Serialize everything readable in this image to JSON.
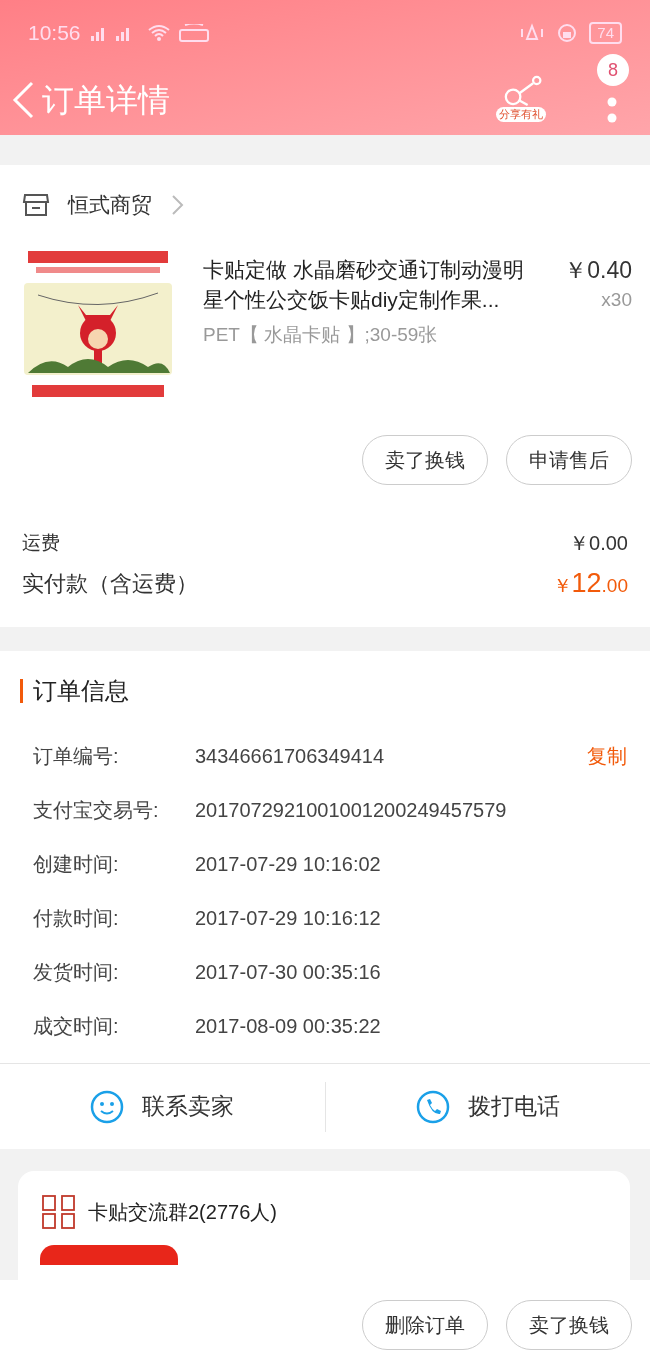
{
  "status_bar": {
    "time": "10:56",
    "battery": "74"
  },
  "header": {
    "title": "订单详情",
    "share_label": "分享有礼",
    "badge": "8"
  },
  "shop": {
    "name": "恒式商贸"
  },
  "product": {
    "kind": "picture",
    "title": "卡贴定做 水晶磨砂交通订制动漫明星个性公交饭卡贴diy定制作果...",
    "sku": "PET【 水晶卡贴 】;30-59张",
    "price": "￥0.40",
    "quantity": "x30"
  },
  "product_actions": [
    "卖了换钱",
    "申请售后"
  ],
  "summary": {
    "shipping_label": "运费",
    "shipping_value": "￥0.00",
    "paid_label": "实付款（含运费）",
    "paid_currency": "￥",
    "paid_integer": "12",
    "paid_decimal": ".00"
  },
  "order_info": {
    "title": "订单信息",
    "copy_label": "复制",
    "rows": [
      {
        "label": "订单编号:",
        "value": "34346661706349414"
      },
      {
        "label": "支付宝交易号:",
        "value": "2017072921001001200249457579"
      },
      {
        "label": "创建时间:",
        "value": "2017-07-29 10:16:02"
      },
      {
        "label": "付款时间:",
        "value": "2017-07-29 10:16:12"
      },
      {
        "label": "发货时间:",
        "value": "2017-07-30 00:35:16"
      },
      {
        "label": "成交时间:",
        "value": "2017-08-09 00:35:22"
      }
    ]
  },
  "contact": [
    {
      "kind": "chat",
      "label": "联系卖家"
    },
    {
      "kind": "phone",
      "label": "拨打电话"
    }
  ],
  "group": {
    "name": "卡贴交流群2(2776人)"
  },
  "bottom_actions": [
    "删除订单",
    "卖了换钱"
  ]
}
